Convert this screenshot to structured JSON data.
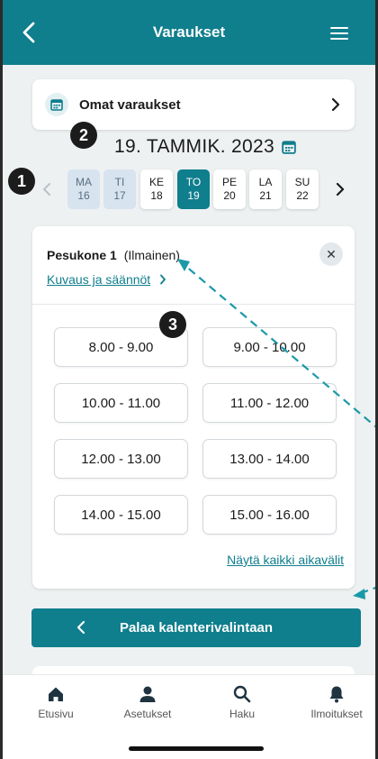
{
  "header": {
    "title": "Varaukset"
  },
  "own_reservations": {
    "label": "Omat varaukset"
  },
  "selected_date": "19. TAMMIK. 2023",
  "badges": [
    "1",
    "2",
    "3"
  ],
  "days": [
    {
      "name": "MA",
      "num": "16",
      "state": "past"
    },
    {
      "name": "TI",
      "num": "17",
      "state": "past"
    },
    {
      "name": "KE",
      "num": "18",
      "state": "future"
    },
    {
      "name": "TO",
      "num": "19",
      "state": "selected"
    },
    {
      "name": "PE",
      "num": "20",
      "state": "future"
    },
    {
      "name": "LA",
      "num": "21",
      "state": "future"
    },
    {
      "name": "SU",
      "num": "22",
      "state": "future"
    }
  ],
  "resource": {
    "name": "Pesukone 1",
    "price": "(Ilmainen)",
    "description_link": "Kuvaus ja säännöt"
  },
  "slots": [
    "8.00 - 9.00",
    "9.00 - 10.00",
    "10.00 - 11.00",
    "11.00 - 12.00",
    "12.00 - 13.00",
    "13.00 - 14.00",
    "14.00 - 15.00",
    "15.00 - 16.00"
  ],
  "show_all": "Näytä kaikki aikavälit",
  "return_button": "Palaa kalenterivalintaan",
  "nav": [
    {
      "label": "Etusivu",
      "icon": "home-icon"
    },
    {
      "label": "Asetukset",
      "icon": "person-icon"
    },
    {
      "label": "Haku",
      "icon": "search-icon"
    },
    {
      "label": "Ilmoitukset",
      "icon": "bell-icon"
    }
  ],
  "colors": {
    "primary": "#0f7e8d",
    "background": "#eef1f2",
    "past_day": "#d7e3ee",
    "annotation_arrow": "#1a9aa8"
  }
}
